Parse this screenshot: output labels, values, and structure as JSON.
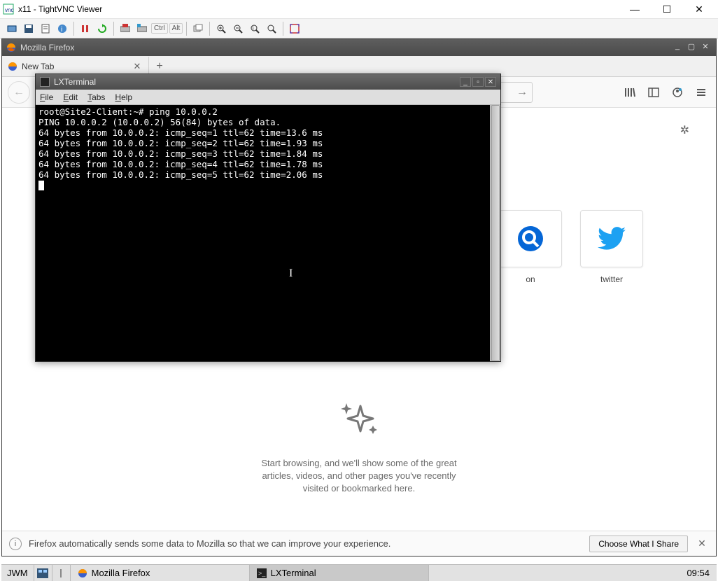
{
  "vnc": {
    "title": "x11 - TightVNC Viewer",
    "keys": {
      "ctrl": "Ctrl",
      "alt": "Alt"
    }
  },
  "firefox": {
    "title": "Mozilla Firefox",
    "tab_label": "New Tab",
    "tiles": [
      {
        "label": "on"
      },
      {
        "label": "twitter"
      }
    ],
    "highlights_text_1": "Start browsing, and we'll show some of the great",
    "highlights_text_2": "articles, videos, and other pages you've recently",
    "highlights_text_3": "visited or bookmarked here.",
    "footer_msg": "Firefox automatically sends some data to Mozilla so that we can improve your experience.",
    "footer_btn": "Choose What I Share"
  },
  "terminal": {
    "title": "LXTerminal",
    "menus": {
      "file": "File",
      "edit": "Edit",
      "tabs": "Tabs",
      "help": "Help"
    },
    "lines": [
      "root@Site2-Client:~# ping 10.0.0.2",
      "PING 10.0.0.2 (10.0.0.2) 56(84) bytes of data.",
      "64 bytes from 10.0.0.2: icmp_seq=1 ttl=62 time=13.6 ms",
      "64 bytes from 10.0.0.2: icmp_seq=2 ttl=62 time=1.93 ms",
      "64 bytes from 10.0.0.2: icmp_seq=3 ttl=62 time=1.84 ms",
      "64 bytes from 10.0.0.2: icmp_seq=4 ttl=62 time=1.78 ms",
      "64 bytes from 10.0.0.2: icmp_seq=5 ttl=62 time=2.06 ms"
    ]
  },
  "taskbar": {
    "menu": "JWM",
    "task1": "Mozilla Firefox",
    "task2": "LXTerminal",
    "clock": "09:54"
  }
}
